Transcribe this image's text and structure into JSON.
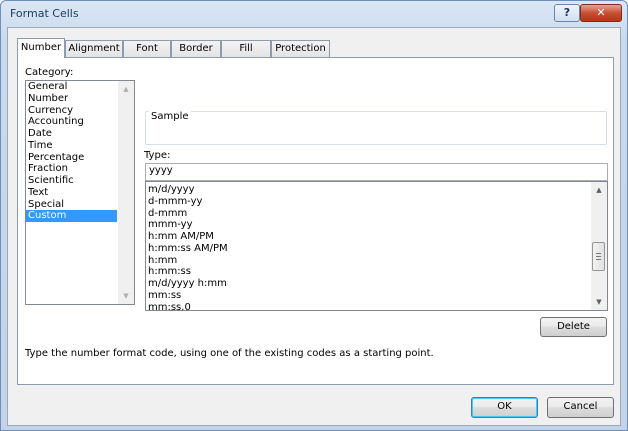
{
  "window": {
    "title": "Format Cells",
    "help_label": "?",
    "close_label": "✕"
  },
  "tabs": [
    "Number",
    "Alignment",
    "Font",
    "Border",
    "Fill",
    "Protection"
  ],
  "active_tab": "Number",
  "category": {
    "label": "Category:",
    "items": [
      "General",
      "Number",
      "Currency",
      "Accounting",
      "Date",
      "Time",
      "Percentage",
      "Fraction",
      "Scientific",
      "Text",
      "Special",
      "Custom"
    ],
    "selected": "Custom"
  },
  "sample": {
    "label": "Sample",
    "value": ""
  },
  "type": {
    "label": "Type:",
    "value": "yyyy",
    "items": [
      "m/d/yyyy",
      "d-mmm-yy",
      "d-mmm",
      "mmm-yy",
      "h:mm AM/PM",
      "h:mm:ss AM/PM",
      "h:mm",
      "h:mm:ss",
      "m/d/yyyy h:mm",
      "mm:ss",
      "mm:ss.0"
    ]
  },
  "delete_label": "Delete",
  "hint": "Type the number format code, using one of the existing codes as a starting point.",
  "ok_label": "OK",
  "cancel_label": "Cancel",
  "icons": {
    "scroll_up": "▲",
    "scroll_down": "▼"
  }
}
